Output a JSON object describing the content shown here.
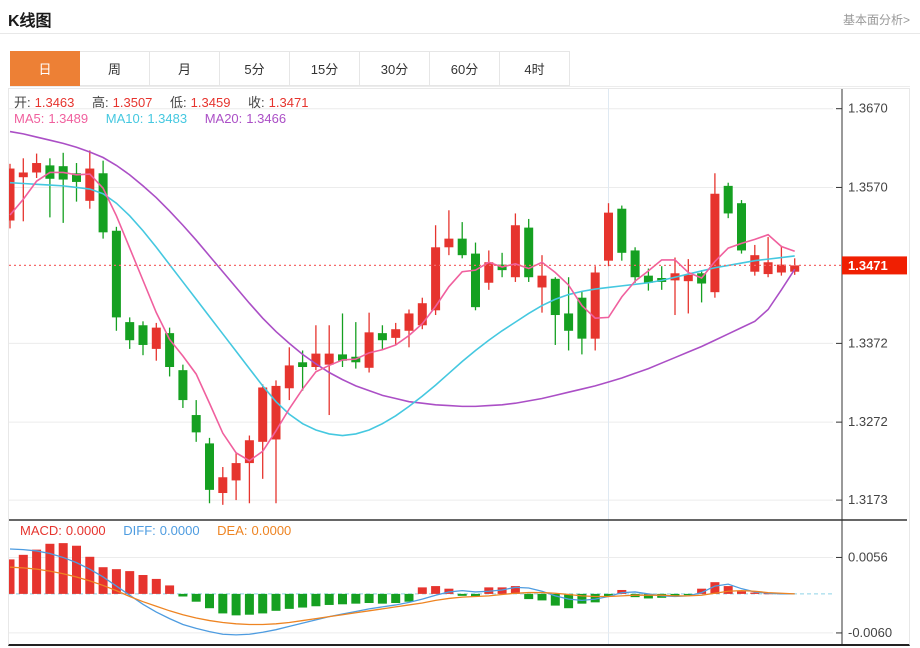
{
  "page": {
    "title": "K线图",
    "link": "基本面分析>"
  },
  "tabs": {
    "items": [
      "日",
      "周",
      "月",
      "5分",
      "15分",
      "30分",
      "60分",
      "4时"
    ],
    "active": "日",
    "active_index": 0
  },
  "info_bar": {
    "open_label": "开:",
    "open": "1.3463",
    "high_label": "高:",
    "high": "1.3507",
    "low_label": "低:",
    "low": "1.3459",
    "close_label": "收:",
    "close": "1.3471"
  },
  "ma_bar": {
    "ma5_label": "MA5:",
    "ma5": "1.3489",
    "ma10_label": "MA10:",
    "ma10": "1.3483",
    "ma20_label": "MA20:",
    "ma20": "1.3466"
  },
  "macd_bar": {
    "macd_label": "MACD:",
    "macd": "0.0000",
    "diff_label": "DIFF:",
    "diff": "0.0000",
    "dea_label": "DEA:",
    "dea": "0.0000"
  },
  "colors": {
    "accent_orange": "#ed8035",
    "up_red": "#e6342e",
    "down_green": "#15a021",
    "ma5_pink": "#f0609e",
    "ma10_cyan": "#45c8e0",
    "ma20_purple": "#ab4fc6",
    "diff_blue": "#4e9ce0",
    "dea_orange": "#ee8422",
    "price_tag_red": "#f01f02",
    "price_line_red": "#f56a6a",
    "zero_line_cyan": "#8fd4e8",
    "grid": "#ececec",
    "vgrid": "#dfe9f2",
    "axis": "#333333",
    "axis_text": "#444444",
    "label_gray": "#444444",
    "link_gray": "#999999"
  },
  "chart_data": [
    {
      "type": "candlestick",
      "title": "K线图 daily candles with MA5/MA10/MA20",
      "ylim": [
        1.3149,
        1.3695
      ],
      "yticks": [
        1.367,
        1.357,
        1.3372,
        1.3272,
        1.3173
      ],
      "current_price": 1.3471,
      "grid": true,
      "vgrid_index": 45,
      "ohlc": [
        [
          1.3528,
          1.36,
          1.3518,
          1.3594
        ],
        [
          1.3583,
          1.3607,
          1.3527,
          1.3589
        ],
        [
          1.3589,
          1.3613,
          1.3582,
          1.3601
        ],
        [
          1.3598,
          1.3607,
          1.3532,
          1.3581
        ],
        [
          1.3597,
          1.3614,
          1.3525,
          1.358
        ],
        [
          1.3588,
          1.3601,
          1.3552,
          1.3577
        ],
        [
          1.3553,
          1.3617,
          1.3543,
          1.3594
        ],
        [
          1.3588,
          1.3604,
          1.3505,
          1.3513
        ],
        [
          1.3515,
          1.352,
          1.3388,
          1.3405
        ],
        [
          1.3399,
          1.3405,
          1.3365,
          1.3376
        ],
        [
          1.3395,
          1.34,
          1.3357,
          1.337
        ],
        [
          1.3365,
          1.3398,
          1.335,
          1.3392
        ],
        [
          1.3385,
          1.3392,
          1.333,
          1.3342
        ],
        [
          1.3338,
          1.3345,
          1.329,
          1.33
        ],
        [
          1.3281,
          1.33,
          1.3247,
          1.3259
        ],
        [
          1.3245,
          1.3252,
          1.3169,
          1.3186
        ],
        [
          1.3182,
          1.3215,
          1.3167,
          1.3202
        ],
        [
          1.3198,
          1.3233,
          1.3173,
          1.322
        ],
        [
          1.322,
          1.3255,
          1.3169,
          1.3249
        ],
        [
          1.3247,
          1.332,
          1.32,
          1.3316
        ],
        [
          1.325,
          1.3325,
          1.3169,
          1.3318
        ],
        [
          1.3315,
          1.3367,
          1.33,
          1.3344
        ],
        [
          1.3348,
          1.3363,
          1.3312,
          1.3342
        ],
        [
          1.3342,
          1.3395,
          1.3338,
          1.3359
        ],
        [
          1.3345,
          1.3395,
          1.3281,
          1.3359
        ],
        [
          1.3358,
          1.341,
          1.3342,
          1.335
        ],
        [
          1.3355,
          1.3399,
          1.334,
          1.3348
        ],
        [
          1.3341,
          1.3411,
          1.3335,
          1.3386
        ],
        [
          1.3385,
          1.3395,
          1.3365,
          1.3376
        ],
        [
          1.3379,
          1.3398,
          1.337,
          1.339
        ],
        [
          1.3388,
          1.3415,
          1.3367,
          1.341
        ],
        [
          1.3395,
          1.343,
          1.339,
          1.3423
        ],
        [
          1.3414,
          1.3522,
          1.3408,
          1.3494
        ],
        [
          1.3494,
          1.3541,
          1.3484,
          1.3505
        ],
        [
          1.3505,
          1.3526,
          1.348,
          1.3484
        ],
        [
          1.3486,
          1.35,
          1.3414,
          1.3418
        ],
        [
          1.3449,
          1.349,
          1.344,
          1.3475
        ],
        [
          1.3472,
          1.3487,
          1.3456,
          1.3465
        ],
        [
          1.3456,
          1.3537,
          1.345,
          1.3522
        ],
        [
          1.3519,
          1.353,
          1.345,
          1.3456
        ],
        [
          1.3443,
          1.3484,
          1.3411,
          1.3458
        ],
        [
          1.3454,
          1.3456,
          1.337,
          1.3408
        ],
        [
          1.341,
          1.3456,
          1.3363,
          1.3388
        ],
        [
          1.343,
          1.3438,
          1.3358,
          1.3378
        ],
        [
          1.3378,
          1.347,
          1.3363,
          1.3462
        ],
        [
          1.3477,
          1.355,
          1.347,
          1.3538
        ],
        [
          1.3543,
          1.3547,
          1.3477,
          1.3487
        ],
        [
          1.349,
          1.3494,
          1.3449,
          1.3456
        ],
        [
          1.3458,
          1.3467,
          1.3439,
          1.3449
        ],
        [
          1.3455,
          1.347,
          1.344,
          1.345
        ],
        [
          1.3452,
          1.3481,
          1.3408,
          1.3461
        ],
        [
          1.3451,
          1.3479,
          1.341,
          1.3459
        ],
        [
          1.3461,
          1.3465,
          1.3424,
          1.3448
        ],
        [
          1.3437,
          1.3588,
          1.343,
          1.3562
        ],
        [
          1.3572,
          1.3576,
          1.3531,
          1.3537
        ],
        [
          1.355,
          1.3554,
          1.3486,
          1.349
        ],
        [
          1.3463,
          1.3497,
          1.3458,
          1.3484
        ],
        [
          1.346,
          1.3507,
          1.3456,
          1.3475
        ],
        [
          1.3462,
          1.3496,
          1.3458,
          1.3472
        ],
        [
          1.3463,
          1.348,
          1.3459,
          1.3471
        ]
      ],
      "series": [
        {
          "name": "MA5",
          "values": [
            1.3535,
            1.3555,
            1.3578,
            1.3589,
            1.3589,
            1.3586,
            1.3587,
            1.3569,
            1.3534,
            1.3493,
            1.3452,
            1.3411,
            1.3377,
            1.3356,
            1.3333,
            1.3296,
            1.3258,
            1.3233,
            1.3223,
            1.3235,
            1.3261,
            1.3289,
            1.3314,
            1.3336,
            1.3344,
            1.3351,
            1.3352,
            1.336,
            1.3364,
            1.337,
            1.3382,
            1.3397,
            1.3419,
            1.3444,
            1.3463,
            1.3465,
            1.3475,
            1.3469,
            1.3473,
            1.3467,
            1.3475,
            1.3462,
            1.3446,
            1.342,
            1.3404,
            1.3405,
            1.3431,
            1.3451,
            1.3464,
            1.3478,
            1.3478,
            1.3462,
            1.3455,
            1.3476,
            1.3493,
            1.3499,
            1.3504,
            1.351,
            1.3495,
            1.3489
          ]
        },
        {
          "name": "MA10",
          "values": [
            1.3576,
            1.3575,
            1.3574,
            1.3573,
            1.3572,
            1.357,
            1.3568,
            1.3562,
            1.355,
            1.3534,
            1.3515,
            1.3494,
            1.3472,
            1.345,
            1.3428,
            1.3406,
            1.3384,
            1.3362,
            1.334,
            1.3318,
            1.3298,
            1.3282,
            1.327,
            1.3262,
            1.3257,
            1.3255,
            1.3257,
            1.3262,
            1.327,
            1.328,
            1.3292,
            1.3305,
            1.3319,
            1.3334,
            1.3349,
            1.3363,
            1.3376,
            1.3388,
            1.3399,
            1.341,
            1.342,
            1.3428,
            1.3434,
            1.3438,
            1.3441,
            1.3443,
            1.3445,
            1.3447,
            1.3449,
            1.3452,
            1.3456,
            1.346,
            1.3464,
            1.3468,
            1.3471,
            1.3474,
            1.3477,
            1.3479,
            1.3481,
            1.3483
          ]
        },
        {
          "name": "MA20",
          "values": [
            1.3641,
            1.3638,
            1.3634,
            1.363,
            1.3626,
            1.3621,
            1.3615,
            1.3608,
            1.3598,
            1.3586,
            1.3572,
            1.3557,
            1.354,
            1.3522,
            1.3503,
            1.3483,
            1.3463,
            1.3443,
            1.3423,
            1.3404,
            1.3387,
            1.3372,
            1.3358,
            1.3346,
            1.3335,
            1.3326,
            1.3318,
            1.3312,
            1.3306,
            1.3302,
            1.3298,
            1.3296,
            1.3294,
            1.3293,
            1.3292,
            1.3292,
            1.3293,
            1.3294,
            1.3296,
            1.3299,
            1.3302,
            1.3306,
            1.331,
            1.3314,
            1.3318,
            1.3323,
            1.3328,
            1.3334,
            1.334,
            1.3347,
            1.3354,
            1.3361,
            1.3368,
            1.3376,
            1.3384,
            1.3392,
            1.34,
            1.3415,
            1.344,
            1.3466
          ]
        }
      ]
    },
    {
      "type": "bar",
      "title": "MACD",
      "ylim": [
        -0.0077,
        0.0112
      ],
      "yticks": [
        0.0056,
        -0.006
      ],
      "zero_line": 0,
      "values": [
        0.0053,
        0.006,
        0.0068,
        0.0077,
        0.0078,
        0.0074,
        0.0057,
        0.0041,
        0.0038,
        0.0035,
        0.0029,
        0.0023,
        0.0013,
        -0.0004,
        -0.0012,
        -0.0022,
        -0.003,
        -0.0033,
        -0.0032,
        -0.003,
        -0.0026,
        -0.0023,
        -0.0021,
        -0.0019,
        -0.0017,
        -0.0016,
        -0.0015,
        -0.0014,
        -0.0015,
        -0.0014,
        -0.0012,
        0.001,
        0.0012,
        0.0008,
        -0.0003,
        -0.0004,
        0.001,
        0.001,
        0.0012,
        -0.0008,
        -0.001,
        -0.0018,
        -0.0022,
        -0.0015,
        -0.0013,
        -0.0004,
        0.0006,
        -0.0005,
        -0.0007,
        -0.0006,
        -0.0003,
        -0.0002,
        0.0008,
        0.0018,
        0.0012,
        0.0004,
        0.0002,
        0.0001,
        0.0001,
        0.0
      ],
      "series": [
        {
          "name": "DIFF",
          "values": [
            0.0069,
            0.0068,
            0.0066,
            0.0062,
            0.0056,
            0.0048,
            0.0038,
            0.0026,
            0.0012,
            -0.0002,
            -0.0016,
            -0.0028,
            -0.0038,
            -0.0047,
            -0.0053,
            -0.0058,
            -0.0062,
            -0.0063,
            -0.0062,
            -0.0059,
            -0.0055,
            -0.005,
            -0.0045,
            -0.004,
            -0.0035,
            -0.0031,
            -0.0027,
            -0.0023,
            -0.002,
            -0.0017,
            -0.0013,
            -0.0008,
            -0.0002,
            0.0003,
            0.0005,
            0.0003,
            0.0004,
            0.0006,
            0.001,
            0.0009,
            0.0004,
            -0.0003,
            -0.0008,
            -0.001,
            -0.0008,
            -0.0004,
            0.0002,
            0.0003,
            0.0,
            -0.0003,
            -0.0004,
            -0.0003,
            0.0002,
            0.0012,
            0.0015,
            0.0008,
            0.0003,
            0.0001,
            0.0,
            0.0
          ]
        },
        {
          "name": "DEA",
          "values": [
            0.0041,
            0.004,
            0.0038,
            0.0035,
            0.0031,
            0.0026,
            0.002,
            0.0013,
            0.0005,
            -0.0004,
            -0.0012,
            -0.0019,
            -0.0026,
            -0.0032,
            -0.0037,
            -0.0041,
            -0.0044,
            -0.0046,
            -0.0047,
            -0.0047,
            -0.0046,
            -0.0044,
            -0.0041,
            -0.0038,
            -0.0035,
            -0.0032,
            -0.0029,
            -0.0026,
            -0.0023,
            -0.002,
            -0.0017,
            -0.0014,
            -0.001,
            -0.0007,
            -0.0005,
            -0.0004,
            -0.0003,
            -0.0001,
            0.0001,
            0.0002,
            0.0002,
            0.0001,
            -0.0001,
            -0.0003,
            -0.0004,
            -0.0004,
            -0.0003,
            -0.0002,
            -0.0002,
            -0.0002,
            -0.0003,
            -0.0003,
            -0.0002,
            0.0001,
            0.0004,
            0.0005,
            0.0004,
            0.0002,
            0.0001,
            0.0
          ]
        }
      ]
    }
  ]
}
